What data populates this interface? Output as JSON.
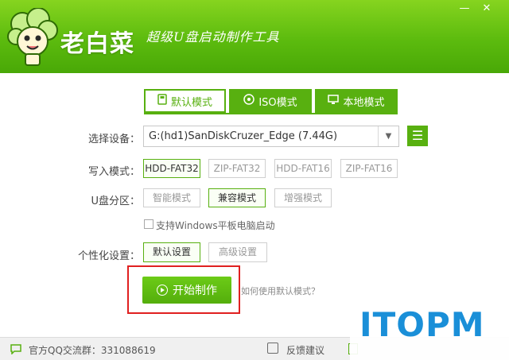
{
  "header": {
    "app_name": "老白菜",
    "slogan": "超级U盘启动制作工具",
    "minimize": "—",
    "close": "✕"
  },
  "tabs": [
    {
      "label": "默认模式",
      "active": true,
      "icon": "usb-drive-icon"
    },
    {
      "label": "ISO模式",
      "active": false,
      "icon": "disc-icon"
    },
    {
      "label": "本地模式",
      "active": false,
      "icon": "monitor-icon"
    }
  ],
  "form": {
    "device_label": "选择设备：",
    "device_value": "G:(hd1)SanDiskCruzer_Edge (7.44G)",
    "write_mode_label": "写入模式：",
    "write_modes": [
      "HDD-FAT32",
      "ZIP-FAT32",
      "HDD-FAT16",
      "ZIP-FAT16"
    ],
    "write_mode_selected": "HDD-FAT32",
    "partition_label": "U盘分区：",
    "partitions": [
      "智能模式",
      "兼容模式",
      "增强模式"
    ],
    "partition_selected": "兼容模式",
    "tablet_checkbox_label": "支持Windows平板电脑启动",
    "tablet_checked": false,
    "personalize_label": "个性化设置：",
    "personalize_options": [
      "默认设置",
      "高级设置"
    ],
    "personalize_selected": "默认设置"
  },
  "actions": {
    "start_label": "开始制作",
    "help_link": "如何使用默认模式？"
  },
  "footer": {
    "qq_group": "官方QQ交流群：331088619",
    "feedback": "反馈建议"
  },
  "watermark": "ITOPM",
  "colors": {
    "brand_green": "#58b010",
    "highlight_red": "#e02020",
    "watermark_blue": "#1a8fd8"
  }
}
